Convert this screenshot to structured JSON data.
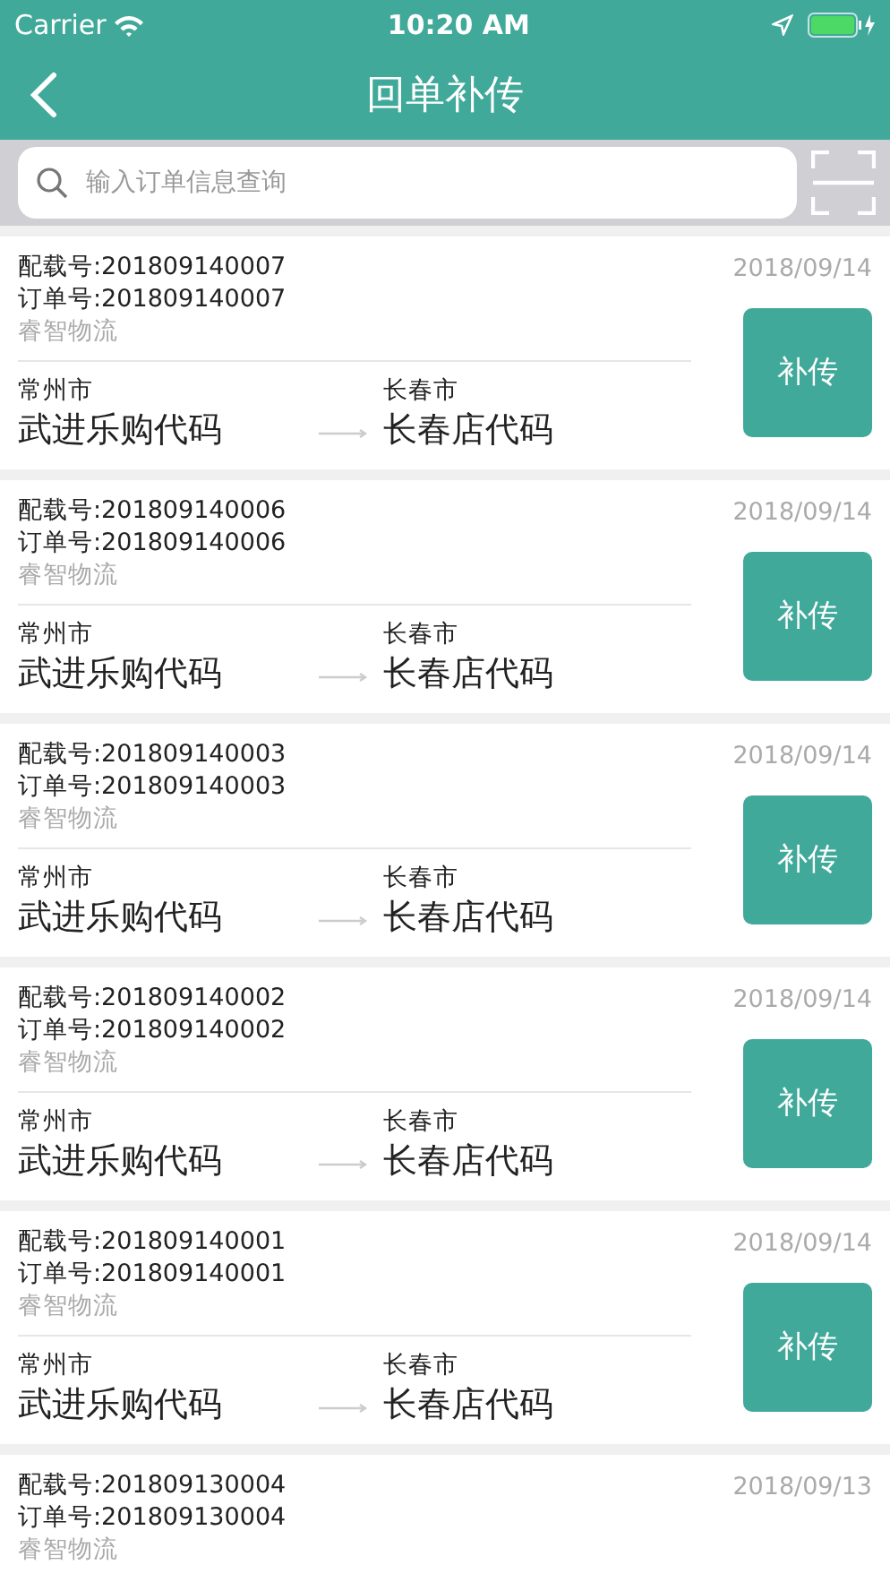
{
  "status_bar": {
    "carrier": "Carrier",
    "time": "10:20 AM"
  },
  "nav": {
    "title": "回单补传"
  },
  "search": {
    "placeholder": "输入订单信息查询"
  },
  "orders": [
    {
      "load_no": "配载号:201809140007",
      "order_no": "订单号:201809140007",
      "company": "睿智物流",
      "date": "2018/09/14",
      "from_city": "常州市",
      "from_name": "武进乐购代码",
      "to_city": "长春市",
      "to_name": "长春店代码",
      "button": "补传"
    },
    {
      "load_no": "配载号:201809140006",
      "order_no": "订单号:201809140006",
      "company": "睿智物流",
      "date": "2018/09/14",
      "from_city": "常州市",
      "from_name": "武进乐购代码",
      "to_city": "长春市",
      "to_name": "长春店代码",
      "button": "补传"
    },
    {
      "load_no": "配载号:201809140003",
      "order_no": "订单号:201809140003",
      "company": "睿智物流",
      "date": "2018/09/14",
      "from_city": "常州市",
      "from_name": "武进乐购代码",
      "to_city": "长春市",
      "to_name": "长春店代码",
      "button": "补传"
    },
    {
      "load_no": "配载号:201809140002",
      "order_no": "订单号:201809140002",
      "company": "睿智物流",
      "date": "2018/09/14",
      "from_city": "常州市",
      "from_name": "武进乐购代码",
      "to_city": "长春市",
      "to_name": "长春店代码",
      "button": "补传"
    },
    {
      "load_no": "配载号:201809140001",
      "order_no": "订单号:201809140001",
      "company": "睿智物流",
      "date": "2018/09/14",
      "from_city": "常州市",
      "from_name": "武进乐购代码",
      "to_city": "长春市",
      "to_name": "长春店代码",
      "button": "补传"
    },
    {
      "load_no": "配载号:201809130004",
      "order_no": "订单号:201809130004",
      "company": "睿智物流",
      "date": "2018/09/13"
    }
  ]
}
